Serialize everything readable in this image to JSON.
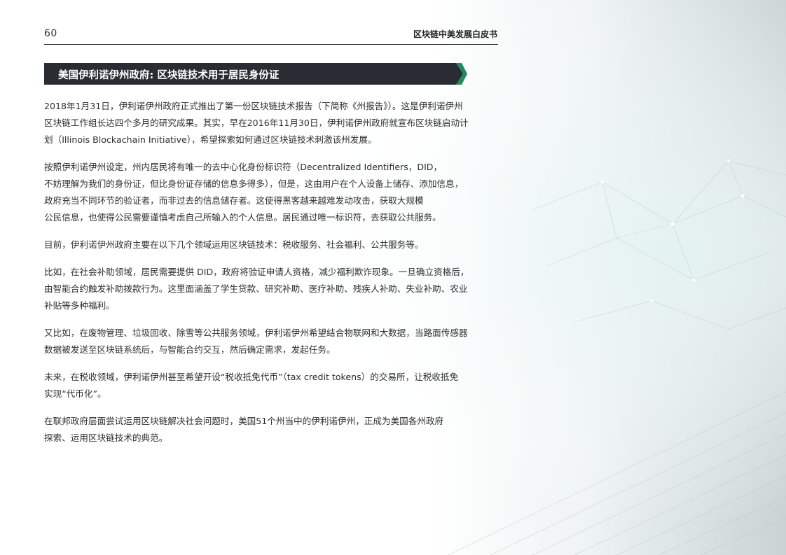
{
  "header": {
    "page_number": "60",
    "doc_title": "区块链中美发展白皮书"
  },
  "section": {
    "title": "美国伊利诺伊州政府: 区块链技术用于居民身份证"
  },
  "paragraphs": [
    {
      "lines": [
        "2018年1月31日，伊利诺伊州政府正式推出了第一份区块链技术报告（下简称《州报告》）。这是伊利诺伊州",
        "区块链工作组长达四个多月的研究成果。其实，早在2016年11月30日，伊利诺伊州政府就宣布区块链启动计",
        "划（Illinois Blockachain Initiative），希望探索如何通过区块链技术刺激该州发展。"
      ]
    },
    {
      "lines": [
        "按照伊利诺伊州设定，州内居民将有唯一的去中心化身份标识符（Decentralized Identifiers，DID，",
        "不妨理解为我们的身份证，但比身份证存储的信息多得多），但是，这由用户在个人设备上储存、添加信息，",
        "政府充当不同环节的验证者，而非过去的信息储存者。这使得黑客越来越难发动攻击，获取大规模",
        "公民信息，也使得公民需要谨慎考虑自己所输入的个人信息。居民通过唯一标识符，去获取公共服务。"
      ]
    },
    {
      "lines": [
        "目前，伊利诺伊州政府主要在以下几个领域运用区块链技术：税收服务、社会福利、公共服务等。"
      ]
    },
    {
      "lines": [
        "比如，在社会补助领域，居民需要提供 DID，政府将验证申请人资格，减少福利欺诈现象。一旦确立资格后，",
        "由智能合约触发补助拨款行为。这里面涵盖了学生贷款、研究补助、医疗补助、残疾人补助、失业补助、农业",
        "补贴等多种福利。"
      ]
    },
    {
      "lines": [
        "又比如，在废物管理、垃圾回收、除雪等公共服务领域，伊利诺伊州希望结合物联网和大数据，当路面传感器",
        "数据被发送至区块链系统后，与智能合约交互，然后确定需求，发起任务。"
      ]
    },
    {
      "lines": [
        "未来，在税收领域，伊利诺伊州甚至希望开设“税收抵免代币”（tax credit tokens）的交易所，让税收抵免",
        "实现“代币化”。"
      ]
    },
    {
      "lines": [
        "在联邦政府层面尝试运用区块链解决社会问题时，美国51个州当中的伊利诺伊州，正成为美国各州政府",
        "探索、运用区块链技术的典范。"
      ]
    }
  ],
  "colors": {
    "banner_bg": "#2a2c33",
    "banner_accent": "#1f8a5a",
    "text": "#2e2e2e",
    "rule": "#333333"
  }
}
